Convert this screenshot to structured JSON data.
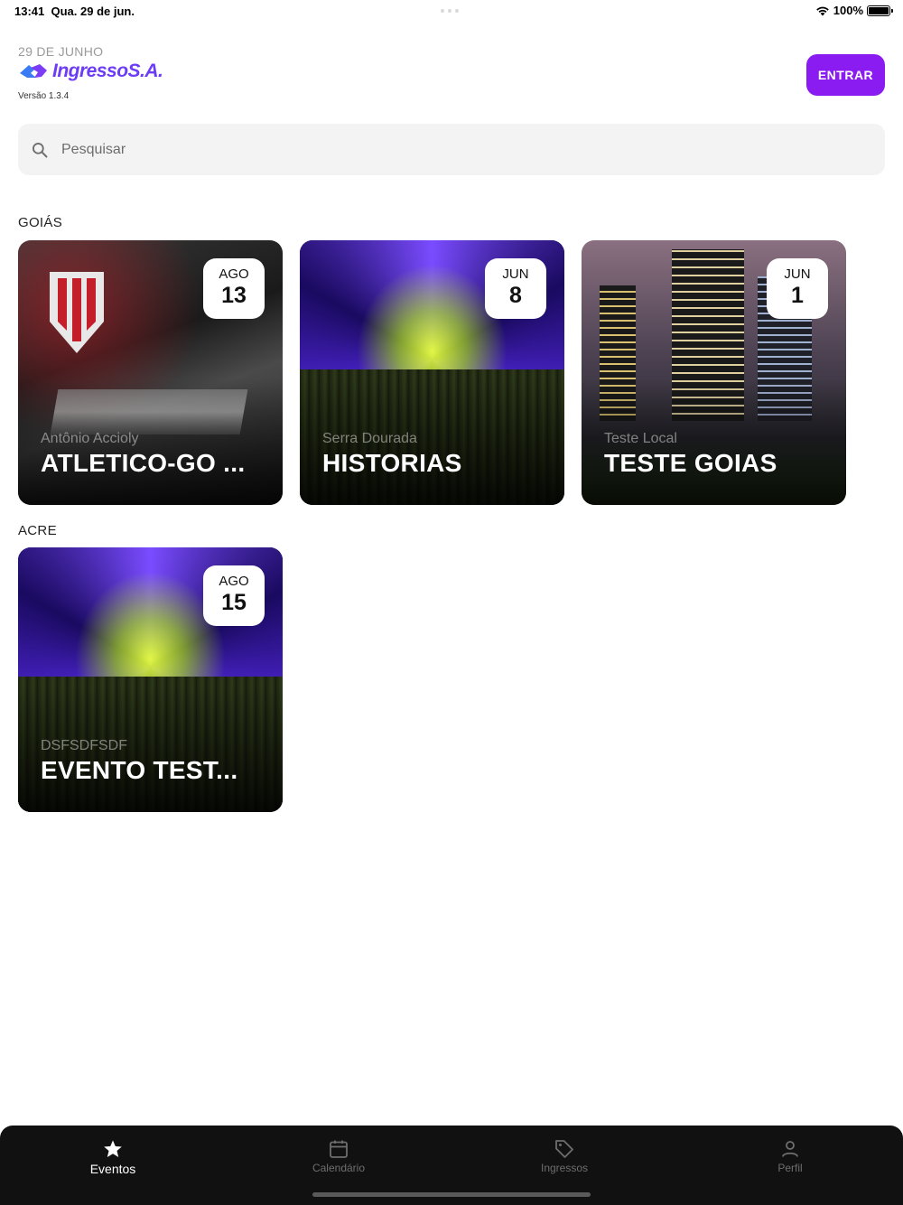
{
  "status_bar": {
    "time": "13:41",
    "date": "Qua. 29 de jun.",
    "battery": "100%"
  },
  "header": {
    "date": "29 DE JUNHO",
    "logo_text": "IngressoS.A.",
    "version": "Versão 1.3.4",
    "login_button": "ENTRAR"
  },
  "search": {
    "placeholder": "Pesquisar"
  },
  "sections": [
    {
      "title": "GOIÁS",
      "events": [
        {
          "month": "AGO",
          "day": "13",
          "venue": "Antônio Accioly",
          "title": "ATLETICO-GO ..."
        },
        {
          "month": "JUN",
          "day": "8",
          "venue": "Serra Dourada",
          "title": "HISTORIAS"
        },
        {
          "month": "JUN",
          "day": "1",
          "venue": "Teste Local",
          "title": "TESTE GOIAS"
        }
      ]
    },
    {
      "title": "ACRE",
      "events": [
        {
          "month": "AGO",
          "day": "15",
          "venue": "DSFSDFSDF",
          "title": "EVENTO TEST..."
        }
      ]
    }
  ],
  "tab_bar": {
    "tabs": [
      {
        "label": "Eventos",
        "icon": "star-icon",
        "active": true
      },
      {
        "label": "Calendário",
        "icon": "calendar-icon",
        "active": false
      },
      {
        "label": "Ingressos",
        "icon": "tag-icon",
        "active": false
      },
      {
        "label": "Perfil",
        "icon": "person-icon",
        "active": false
      }
    ]
  },
  "colors": {
    "accent": "#8a1cf2",
    "logo": "#6d3cf5",
    "tab_bar": "#111111"
  }
}
